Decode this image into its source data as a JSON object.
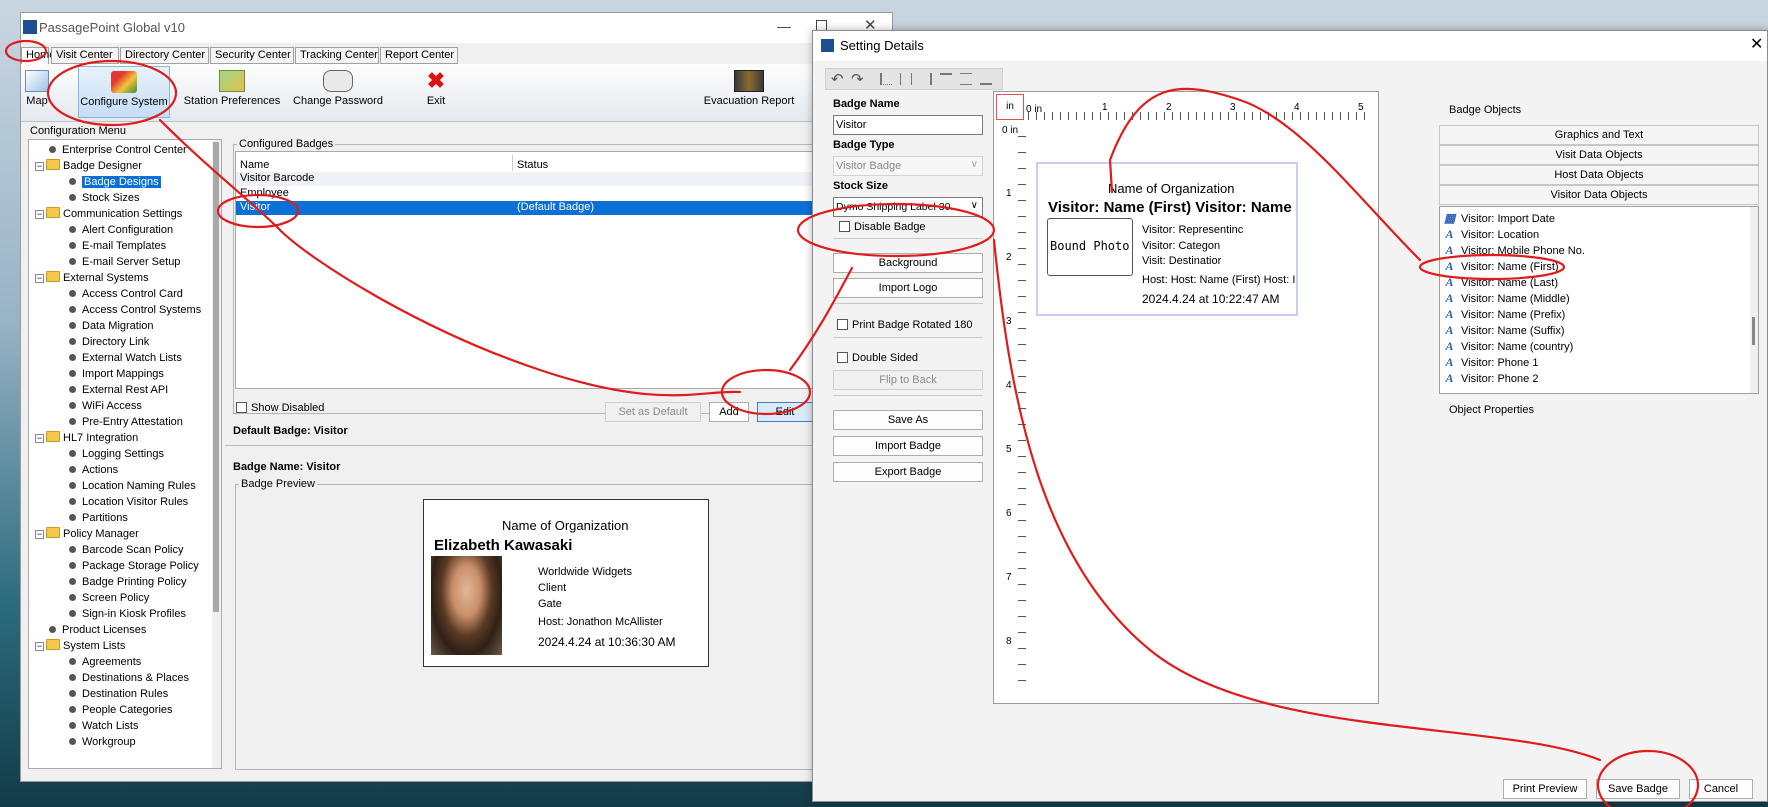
{
  "main_window": {
    "title": "PassagePoint Global v10",
    "tabs": [
      "Home",
      "Visit Center",
      "Directory Center",
      "Security Center",
      "Tracking Center",
      "Report Center"
    ],
    "ribbon": [
      "Map",
      "Configure System",
      "Station Preferences",
      "Change Password",
      "Exit",
      "Evacuation Report"
    ],
    "config_menu_title": "Configuration Menu",
    "tree": [
      {
        "label": "Enterprise Control Center",
        "level": 1,
        "type": "bullet"
      },
      {
        "label": "Badge Designer",
        "level": 1,
        "type": "folder"
      },
      {
        "label": "Badge Designs",
        "level": 2,
        "type": "bullet",
        "selected": true
      },
      {
        "label": "Stock Sizes",
        "level": 2,
        "type": "bullet"
      },
      {
        "label": "Communication Settings",
        "level": 1,
        "type": "folder"
      },
      {
        "label": "Alert Configuration",
        "level": 2,
        "type": "bullet"
      },
      {
        "label": "E-mail Templates",
        "level": 2,
        "type": "bullet"
      },
      {
        "label": "E-mail Server Setup",
        "level": 2,
        "type": "bullet"
      },
      {
        "label": "External Systems",
        "level": 1,
        "type": "folder"
      },
      {
        "label": "Access Control Card",
        "level": 2,
        "type": "bullet"
      },
      {
        "label": "Access Control Systems",
        "level": 2,
        "type": "bullet"
      },
      {
        "label": "Data Migration",
        "level": 2,
        "type": "bullet"
      },
      {
        "label": "Directory Link",
        "level": 2,
        "type": "bullet"
      },
      {
        "label": "External Watch Lists",
        "level": 2,
        "type": "bullet"
      },
      {
        "label": "Import Mappings",
        "level": 2,
        "type": "bullet"
      },
      {
        "label": "External Rest API",
        "level": 2,
        "type": "bullet"
      },
      {
        "label": "WiFi Access",
        "level": 2,
        "type": "bullet"
      },
      {
        "label": "Pre-Entry Attestation",
        "level": 2,
        "type": "bullet"
      },
      {
        "label": "HL7 Integration",
        "level": 1,
        "type": "folder"
      },
      {
        "label": "Logging Settings",
        "level": 2,
        "type": "bullet"
      },
      {
        "label": "Actions",
        "level": 2,
        "type": "bullet"
      },
      {
        "label": "Location Naming Rules",
        "level": 2,
        "type": "bullet"
      },
      {
        "label": "Location Visitor Rules",
        "level": 2,
        "type": "bullet"
      },
      {
        "label": "Partitions",
        "level": 2,
        "type": "bullet"
      },
      {
        "label": "Policy Manager",
        "level": 1,
        "type": "folder"
      },
      {
        "label": "Barcode Scan Policy",
        "level": 2,
        "type": "bullet"
      },
      {
        "label": "Package Storage Policy",
        "level": 2,
        "type": "bullet"
      },
      {
        "label": "Badge Printing Policy",
        "level": 2,
        "type": "bullet"
      },
      {
        "label": "Screen Policy",
        "level": 2,
        "type": "bullet"
      },
      {
        "label": "Sign-in Kiosk Profiles",
        "level": 2,
        "type": "bullet"
      },
      {
        "label": "Product Licenses",
        "level": 1,
        "type": "bullet"
      },
      {
        "label": "System Lists",
        "level": 1,
        "type": "folder"
      },
      {
        "label": "Agreements",
        "level": 2,
        "type": "bullet"
      },
      {
        "label": "Destinations & Places",
        "level": 2,
        "type": "bullet"
      },
      {
        "label": "Destination Rules",
        "level": 2,
        "type": "bullet"
      },
      {
        "label": "People Categories",
        "level": 2,
        "type": "bullet"
      },
      {
        "label": "Watch Lists",
        "level": 2,
        "type": "bullet"
      },
      {
        "label": "Workgroup",
        "level": 2,
        "type": "bullet"
      }
    ],
    "configured_badges": {
      "title": "Configured Badges",
      "col_name": "Name",
      "col_status": "Status",
      "rows": [
        {
          "name": "Visitor Barcode",
          "status": ""
        },
        {
          "name": "Employee",
          "status": ""
        },
        {
          "name": "Visitor",
          "status": "(Default Badge)"
        }
      ]
    },
    "show_disabled": "Show Disabled",
    "set_default": "Set as Default",
    "add": "Add",
    "edit": "Edit",
    "default_badge": "Default Badge: Visitor",
    "badge_name_line": "Badge Name:  Visitor",
    "badge_preview_title": "Badge Preview",
    "preview": {
      "org": "Name of Organization",
      "person": "Elizabeth Kawasaki",
      "company": "Worldwide Widgets",
      "category": "Client",
      "destination": "Gate",
      "host": "Host:  Jonathon McAllister",
      "date": "2024.4.24 at 10:36:30 AM"
    }
  },
  "setting_details": {
    "title": "Setting Details",
    "badge_name_label": "Badge Name",
    "badge_name_value": "Visitor",
    "badge_type_label": "Badge Type",
    "badge_type_value": "Visitor Badge",
    "stock_size_label": "Stock Size",
    "stock_size_value": "Dymo Shipping Label 30...",
    "disable_badge": "Disable Badge",
    "background": "Background",
    "import_logo": "Import Logo",
    "print_rotated": "Print Badge Rotated 180",
    "double_sided": "Double Sided",
    "flip_to_back": "Flip to Back",
    "save_as": "Save As",
    "import_badge": "Import Badge",
    "export_badge": "Export Badge",
    "ruler_unit": "in",
    "ruler_h": [
      "0 in",
      "1",
      "2",
      "3",
      "4",
      "5"
    ],
    "ruler_v": [
      "0 in",
      "1",
      "2",
      "3",
      "4",
      "5",
      "6",
      "7",
      "8"
    ],
    "canvas": {
      "org": "Name of Organization",
      "name_line": "Visitor: Name (First) Visitor: Name (L",
      "photo": "Bound Photo",
      "representing": "Visitor: Representinc",
      "category": "Visitor: Categon",
      "destination": "Visit: Destinatior",
      "host": "Host:  Host: Name (First) Host: I",
      "date": "2024.4.24 at 10:22:47 AM"
    },
    "badge_objects_title": "Badge Objects",
    "object_sections": [
      "Graphics and Text",
      "Visit Data Objects",
      "Host Data Objects",
      "Visitor Data Objects"
    ],
    "visitor_objects": [
      "Visitor: Import Date",
      "Visitor: Location",
      "Visitor: Mobile Phone No.",
      "Visitor: Name (First)",
      "Visitor: Name (Last)",
      "Visitor: Name (Middle)",
      "Visitor: Name (Prefix)",
      "Visitor: Name (Suffix)",
      "Visitor: Name (country)",
      "Visitor: Phone 1",
      "Visitor: Phone 2"
    ],
    "object_properties_title": "Object Properties",
    "print_preview": "Print Preview",
    "save_badge": "Save Badge",
    "cancel": "Cancel"
  }
}
